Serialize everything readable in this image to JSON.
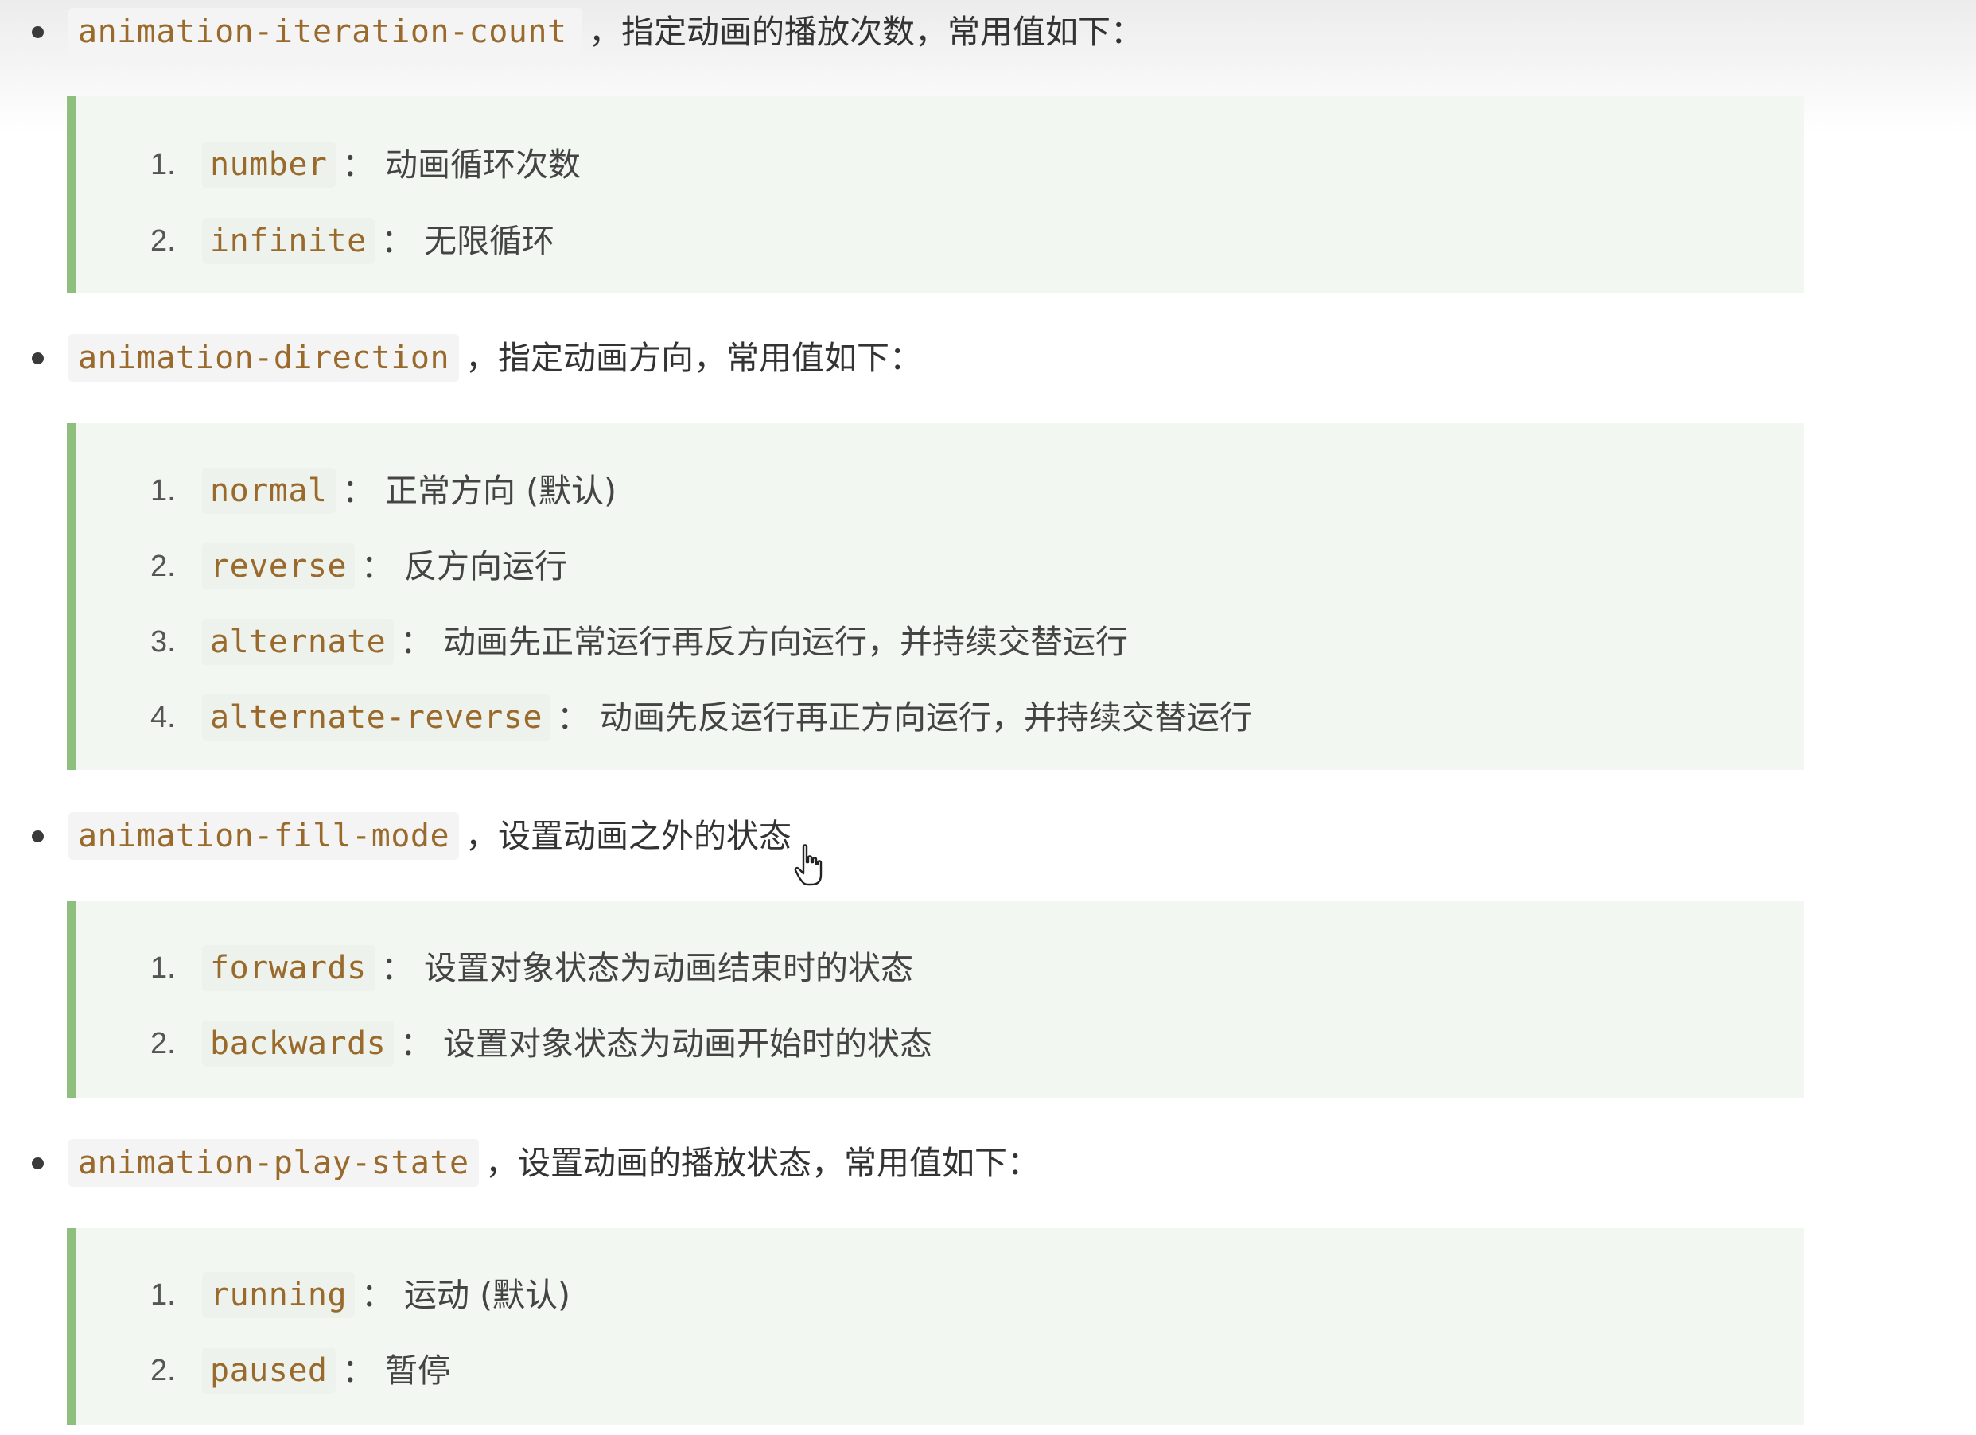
{
  "sections": [
    {
      "property": "animation-iteration-count",
      "description": "，指定动画的播放次数，常用值如下：",
      "items": [
        {
          "num": "1.",
          "value": "number",
          "desc": "：  动画循环次数"
        },
        {
          "num": "2.",
          "value": "infinite",
          "desc": "：  无限循环"
        }
      ]
    },
    {
      "property": "animation-direction",
      "description": "，指定动画方向，常用值如下：",
      "items": [
        {
          "num": "1.",
          "value": "normal",
          "desc": "：  正常方向 (默认)"
        },
        {
          "num": "2.",
          "value": "reverse",
          "desc": "：  反方向运行"
        },
        {
          "num": "3.",
          "value": "alternate",
          "desc": "：  动画先正常运行再反方向运行，并持续交替运行"
        },
        {
          "num": "4.",
          "value": "alternate-reverse",
          "desc": "：  动画先反运行再正方向运行，并持续交替运行"
        }
      ]
    },
    {
      "property": "animation-fill-mode",
      "description": "，设置动画之外的状态",
      "items": [
        {
          "num": "1.",
          "value": "forwards",
          "desc": "：  设置对象状态为动画结束时的状态"
        },
        {
          "num": "2.",
          "value": "backwards",
          "desc": "：  设置对象状态为动画开始时的状态"
        }
      ]
    },
    {
      "property": "animation-play-state",
      "description": "，设置动画的播放状态，常用值如下：",
      "items": [
        {
          "num": "1.",
          "value": "running",
          "desc": "：  运动 (默认)"
        },
        {
          "num": "2.",
          "value": "paused",
          "desc": "：  暂停"
        }
      ]
    }
  ],
  "colors": {
    "code_text": "#9a6a2c",
    "quote_border": "#8fbf7f",
    "quote_bg": "#f3f7f1"
  },
  "cursor": {
    "icon": "hand-pointer-icon"
  }
}
